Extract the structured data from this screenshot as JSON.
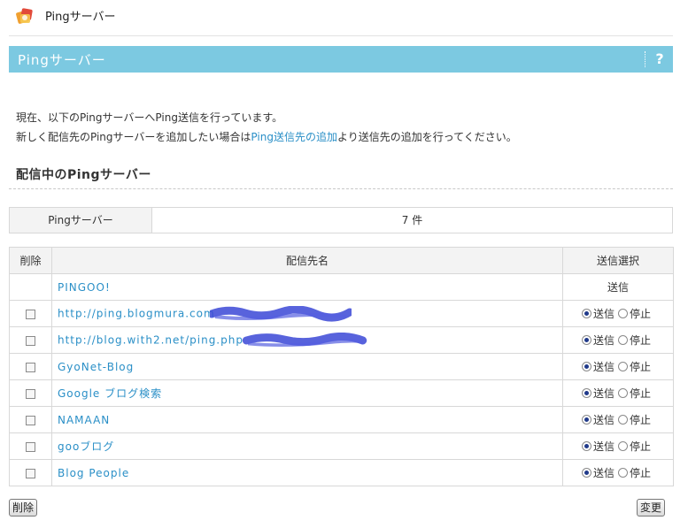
{
  "header": {
    "title": "Pingサーバー"
  },
  "banner": {
    "title": "Pingサーバー",
    "help": "?"
  },
  "description": {
    "line1": "現在、以下のPingサーバーへPing送信を行っています。",
    "line2_prefix": "新しく配信先のPingサーバーを追加したい場合は",
    "line2_link": "Ping送信先の追加",
    "line2_suffix": "より送信先の追加を行ってください。"
  },
  "section": {
    "title": "配信中のPingサーバー"
  },
  "summary": {
    "label": "Pingサーバー",
    "value": "7 件"
  },
  "table": {
    "headers": {
      "delete": "削除",
      "name": "配信先名",
      "select": "送信選択"
    },
    "rows": [
      {
        "name": "PINGOO!",
        "fixed": "送信",
        "checkbox": false
      },
      {
        "name": "http://ping.blogmura.com",
        "checkbox": true,
        "send": "送信",
        "stop": "停止",
        "selected": "send"
      },
      {
        "name": "http://blog.with2.net/ping.php",
        "checkbox": true,
        "send": "送信",
        "stop": "停止",
        "selected": "send"
      },
      {
        "name": "GyoNet-Blog",
        "checkbox": true,
        "send": "送信",
        "stop": "停止",
        "selected": "send"
      },
      {
        "name": "Google ブログ検索",
        "checkbox": true,
        "send": "送信",
        "stop": "停止",
        "selected": "send"
      },
      {
        "name": "NAMAAN",
        "checkbox": true,
        "send": "送信",
        "stop": "停止",
        "selected": "send"
      },
      {
        "name": "gooブログ",
        "checkbox": true,
        "send": "送信",
        "stop": "停止",
        "selected": "send"
      },
      {
        "name": "Blog People",
        "checkbox": true,
        "send": "送信",
        "stop": "停止",
        "selected": "send"
      }
    ]
  },
  "buttons": {
    "delete": "削除",
    "change": "変更"
  },
  "colors": {
    "banner": "#7cc9e1",
    "link": "#2a8fc7",
    "redaction": "#3b48d6"
  }
}
